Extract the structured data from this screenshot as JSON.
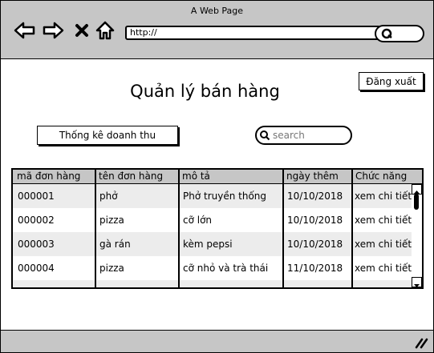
{
  "window": {
    "title": "A Web Page"
  },
  "browser": {
    "url": "http://"
  },
  "header": {
    "title": "Quản lý bán hàng",
    "logout_label": "Đăng xuất"
  },
  "toolbar": {
    "stats_label": "Thống kê doanh thu",
    "search_placeholder": "search"
  },
  "table": {
    "columns": [
      "mã đơn hàng",
      "tên đơn hàng",
      "mô tả",
      "ngày thêm",
      "Chức năng"
    ],
    "rows": [
      [
        "000001",
        "phở",
        "Phở truyền thống",
        "10/10/2018",
        "xem chi tiết"
      ],
      [
        "000002",
        "pizza",
        "cỡ lớn",
        "10/10/2018",
        "xem chi tiết"
      ],
      [
        "000003",
        "gà rán",
        "kèm pepsi",
        "10/10/2018",
        "xem chi tiết"
      ],
      [
        "000004",
        "pizza",
        "cỡ nhỏ và trà thái",
        "11/10/2018",
        "xem chi tiết"
      ]
    ]
  },
  "icons": [
    "back-arrow-icon",
    "forward-arrow-icon",
    "close-icon",
    "home-icon",
    "search-icon",
    "resize-grip-icon"
  ]
}
